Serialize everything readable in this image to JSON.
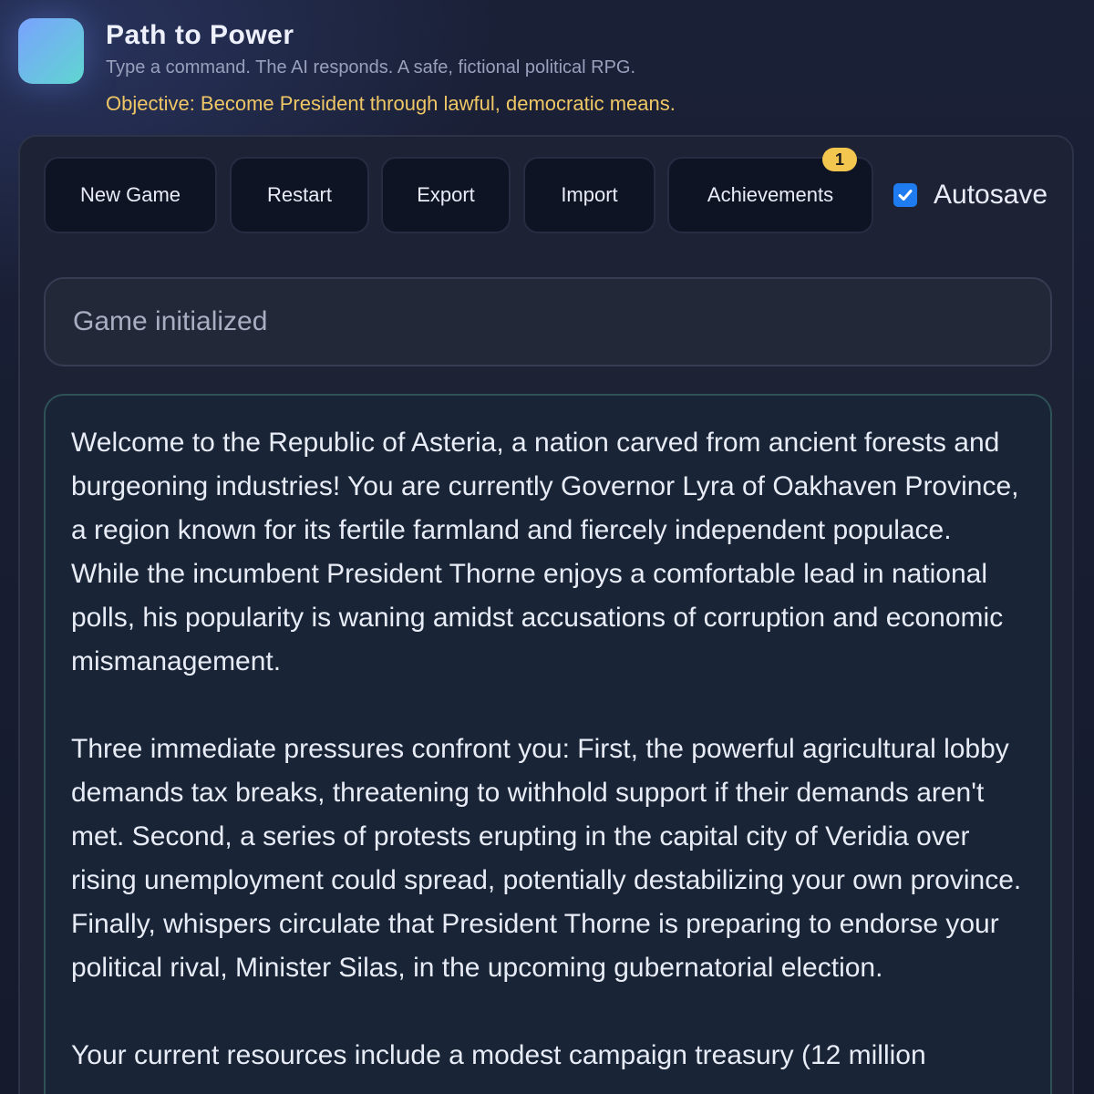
{
  "app": {
    "title": "Path to Power",
    "subtitle": "Type a command. The AI responds. A safe, fictional political RPG.",
    "objective": "Objective: Become President through lawful, democratic means."
  },
  "toolbar": {
    "new_game": "New Game",
    "restart": "Restart",
    "export": "Export",
    "import": "Import",
    "achievements": "Achievements",
    "achievements_badge": "1",
    "autosave_label": "Autosave",
    "autosave_checked": true
  },
  "status": {
    "text": "Game initialized"
  },
  "story": {
    "paragraphs": [
      "Welcome to the Republic of Asteria, a nation carved from ancient forests and burgeoning industries! You are currently Governor Lyra of Oakhaven Province, a region known for its fertile farmland and fiercely independent populace. While the incumbent President Thorne enjoys a comfortable lead in national polls, his popularity is waning amidst accusations of corruption and economic mismanagement.",
      "Three immediate pressures confront you: First, the powerful agricultural lobby demands tax breaks, threatening to withhold support if their demands aren't met. Second, a series of protests erupting in the capital city of Veridia over rising unemployment could spread, potentially destabilizing your own province. Finally, whispers circulate that President Thorne is preparing to endorse your political rival, Minister Silas, in the upcoming gubernatorial election.",
      "Your current resources include a modest campaign treasury (12 million"
    ]
  },
  "colors": {
    "accent_blue": "#7aa2ff",
    "accent_teal": "#5fd6d0",
    "objective_gold": "#f0c766",
    "badge_gold": "#f3c64f",
    "checkbox_blue": "#1e7cf0"
  },
  "icons": {
    "logo": "app-logo-gradient",
    "checkbox": "checkmark-icon"
  }
}
